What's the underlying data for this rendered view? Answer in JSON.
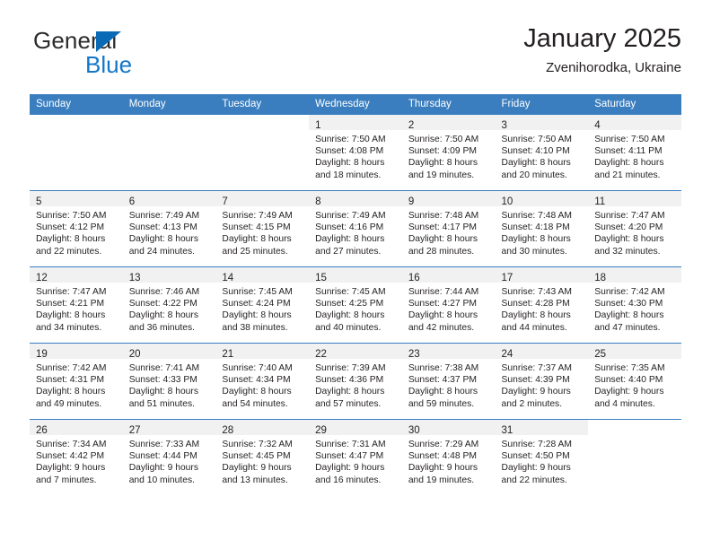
{
  "brand": {
    "name_part1": "General",
    "name_part2": "Blue",
    "logo_icon": "triangle-flag-icon"
  },
  "header": {
    "title": "January 2025",
    "subtitle": "Zvenihorodka, Ukraine"
  },
  "colors": {
    "header_blue": "#3a7ebf",
    "daynum_bar": "#f1f1f1",
    "brand_blue": "#1277c8",
    "text": "#231f20"
  },
  "weekdays": [
    "Sunday",
    "Monday",
    "Tuesday",
    "Wednesday",
    "Thursday",
    "Friday",
    "Saturday"
  ],
  "weeks": [
    [
      {
        "blank": true
      },
      {
        "blank": true
      },
      {
        "blank": true
      },
      {
        "day": "1",
        "sunrise": "Sunrise: 7:50 AM",
        "sunset": "Sunset: 4:08 PM",
        "daylight1": "Daylight: 8 hours",
        "daylight2": "and 18 minutes."
      },
      {
        "day": "2",
        "sunrise": "Sunrise: 7:50 AM",
        "sunset": "Sunset: 4:09 PM",
        "daylight1": "Daylight: 8 hours",
        "daylight2": "and 19 minutes."
      },
      {
        "day": "3",
        "sunrise": "Sunrise: 7:50 AM",
        "sunset": "Sunset: 4:10 PM",
        "daylight1": "Daylight: 8 hours",
        "daylight2": "and 20 minutes."
      },
      {
        "day": "4",
        "sunrise": "Sunrise: 7:50 AM",
        "sunset": "Sunset: 4:11 PM",
        "daylight1": "Daylight: 8 hours",
        "daylight2": "and 21 minutes."
      }
    ],
    [
      {
        "day": "5",
        "sunrise": "Sunrise: 7:50 AM",
        "sunset": "Sunset: 4:12 PM",
        "daylight1": "Daylight: 8 hours",
        "daylight2": "and 22 minutes."
      },
      {
        "day": "6",
        "sunrise": "Sunrise: 7:49 AM",
        "sunset": "Sunset: 4:13 PM",
        "daylight1": "Daylight: 8 hours",
        "daylight2": "and 24 minutes."
      },
      {
        "day": "7",
        "sunrise": "Sunrise: 7:49 AM",
        "sunset": "Sunset: 4:15 PM",
        "daylight1": "Daylight: 8 hours",
        "daylight2": "and 25 minutes."
      },
      {
        "day": "8",
        "sunrise": "Sunrise: 7:49 AM",
        "sunset": "Sunset: 4:16 PM",
        "daylight1": "Daylight: 8 hours",
        "daylight2": "and 27 minutes."
      },
      {
        "day": "9",
        "sunrise": "Sunrise: 7:48 AM",
        "sunset": "Sunset: 4:17 PM",
        "daylight1": "Daylight: 8 hours",
        "daylight2": "and 28 minutes."
      },
      {
        "day": "10",
        "sunrise": "Sunrise: 7:48 AM",
        "sunset": "Sunset: 4:18 PM",
        "daylight1": "Daylight: 8 hours",
        "daylight2": "and 30 minutes."
      },
      {
        "day": "11",
        "sunrise": "Sunrise: 7:47 AM",
        "sunset": "Sunset: 4:20 PM",
        "daylight1": "Daylight: 8 hours",
        "daylight2": "and 32 minutes."
      }
    ],
    [
      {
        "day": "12",
        "sunrise": "Sunrise: 7:47 AM",
        "sunset": "Sunset: 4:21 PM",
        "daylight1": "Daylight: 8 hours",
        "daylight2": "and 34 minutes."
      },
      {
        "day": "13",
        "sunrise": "Sunrise: 7:46 AM",
        "sunset": "Sunset: 4:22 PM",
        "daylight1": "Daylight: 8 hours",
        "daylight2": "and 36 minutes."
      },
      {
        "day": "14",
        "sunrise": "Sunrise: 7:45 AM",
        "sunset": "Sunset: 4:24 PM",
        "daylight1": "Daylight: 8 hours",
        "daylight2": "and 38 minutes."
      },
      {
        "day": "15",
        "sunrise": "Sunrise: 7:45 AM",
        "sunset": "Sunset: 4:25 PM",
        "daylight1": "Daylight: 8 hours",
        "daylight2": "and 40 minutes."
      },
      {
        "day": "16",
        "sunrise": "Sunrise: 7:44 AM",
        "sunset": "Sunset: 4:27 PM",
        "daylight1": "Daylight: 8 hours",
        "daylight2": "and 42 minutes."
      },
      {
        "day": "17",
        "sunrise": "Sunrise: 7:43 AM",
        "sunset": "Sunset: 4:28 PM",
        "daylight1": "Daylight: 8 hours",
        "daylight2": "and 44 minutes."
      },
      {
        "day": "18",
        "sunrise": "Sunrise: 7:42 AM",
        "sunset": "Sunset: 4:30 PM",
        "daylight1": "Daylight: 8 hours",
        "daylight2": "and 47 minutes."
      }
    ],
    [
      {
        "day": "19",
        "sunrise": "Sunrise: 7:42 AM",
        "sunset": "Sunset: 4:31 PM",
        "daylight1": "Daylight: 8 hours",
        "daylight2": "and 49 minutes."
      },
      {
        "day": "20",
        "sunrise": "Sunrise: 7:41 AM",
        "sunset": "Sunset: 4:33 PM",
        "daylight1": "Daylight: 8 hours",
        "daylight2": "and 51 minutes."
      },
      {
        "day": "21",
        "sunrise": "Sunrise: 7:40 AM",
        "sunset": "Sunset: 4:34 PM",
        "daylight1": "Daylight: 8 hours",
        "daylight2": "and 54 minutes."
      },
      {
        "day": "22",
        "sunrise": "Sunrise: 7:39 AM",
        "sunset": "Sunset: 4:36 PM",
        "daylight1": "Daylight: 8 hours",
        "daylight2": "and 57 minutes."
      },
      {
        "day": "23",
        "sunrise": "Sunrise: 7:38 AM",
        "sunset": "Sunset: 4:37 PM",
        "daylight1": "Daylight: 8 hours",
        "daylight2": "and 59 minutes."
      },
      {
        "day": "24",
        "sunrise": "Sunrise: 7:37 AM",
        "sunset": "Sunset: 4:39 PM",
        "daylight1": "Daylight: 9 hours",
        "daylight2": "and 2 minutes."
      },
      {
        "day": "25",
        "sunrise": "Sunrise: 7:35 AM",
        "sunset": "Sunset: 4:40 PM",
        "daylight1": "Daylight: 9 hours",
        "daylight2": "and 4 minutes."
      }
    ],
    [
      {
        "day": "26",
        "sunrise": "Sunrise: 7:34 AM",
        "sunset": "Sunset: 4:42 PM",
        "daylight1": "Daylight: 9 hours",
        "daylight2": "and 7 minutes."
      },
      {
        "day": "27",
        "sunrise": "Sunrise: 7:33 AM",
        "sunset": "Sunset: 4:44 PM",
        "daylight1": "Daylight: 9 hours",
        "daylight2": "and 10 minutes."
      },
      {
        "day": "28",
        "sunrise": "Sunrise: 7:32 AM",
        "sunset": "Sunset: 4:45 PM",
        "daylight1": "Daylight: 9 hours",
        "daylight2": "and 13 minutes."
      },
      {
        "day": "29",
        "sunrise": "Sunrise: 7:31 AM",
        "sunset": "Sunset: 4:47 PM",
        "daylight1": "Daylight: 9 hours",
        "daylight2": "and 16 minutes."
      },
      {
        "day": "30",
        "sunrise": "Sunrise: 7:29 AM",
        "sunset": "Sunset: 4:48 PM",
        "daylight1": "Daylight: 9 hours",
        "daylight2": "and 19 minutes."
      },
      {
        "day": "31",
        "sunrise": "Sunrise: 7:28 AM",
        "sunset": "Sunset: 4:50 PM",
        "daylight1": "Daylight: 9 hours",
        "daylight2": "and 22 minutes."
      },
      {
        "blank": true
      }
    ]
  ]
}
